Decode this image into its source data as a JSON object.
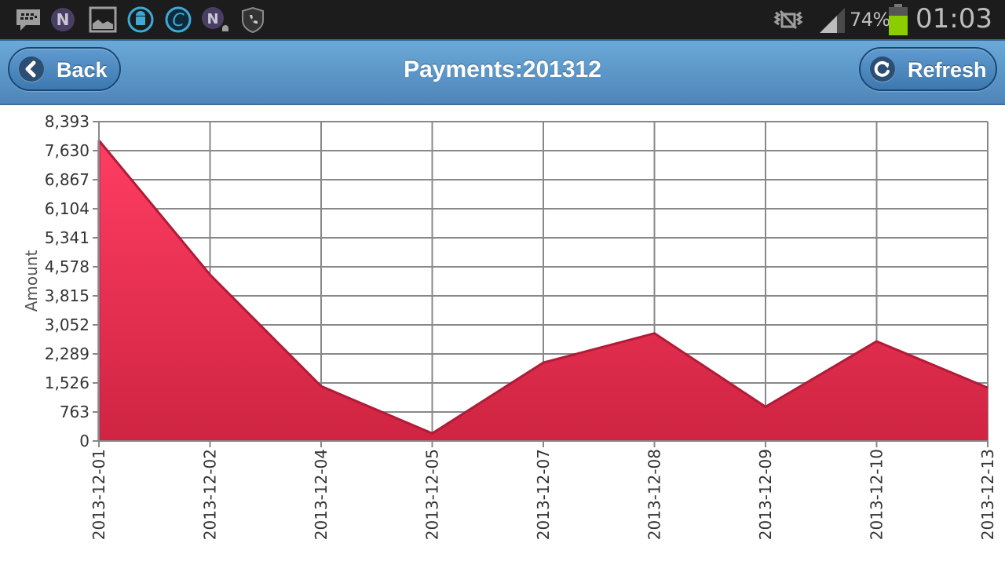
{
  "status_bar": {
    "left_icons": [
      "bbm-icon",
      "notification-n-icon",
      "gallery-image-icon",
      "android-sync-icon",
      "c-app-icon",
      "notification-n-bell-icon",
      "shield-phone-icon"
    ],
    "right_icons": [
      "vibrate-mute-icon",
      "signal-icon",
      "battery-icon"
    ],
    "battery_percent": "74%",
    "time": "01:03",
    "battery_color": "#8ccc00"
  },
  "header": {
    "title": "Payments:201312",
    "back_label": "Back",
    "refresh_label": "Refresh",
    "header_color": "#5b95c7"
  },
  "chart_data": {
    "type": "area",
    "title": "",
    "xlabel": "",
    "ylabel": "Amount",
    "categories": [
      "2013-12-01",
      "2013-12-02",
      "2013-12-04",
      "2013-12-05",
      "2013-12-07",
      "2013-12-08",
      "2013-12-09",
      "2013-12-10",
      "2013-12-13"
    ],
    "series": [
      {
        "name": "Amount",
        "values": [
          7900,
          4370,
          1440,
          200,
          2060,
          2830,
          900,
          2620,
          1400
        ],
        "color": "#d62a48"
      }
    ],
    "yticks": [
      0,
      763,
      1526,
      2289,
      3052,
      3815,
      4578,
      5341,
      6104,
      6867,
      7630,
      8393
    ],
    "ytick_labels": [
      "0",
      "763",
      "1,526",
      "2,289",
      "3,052",
      "3,815",
      "4,578",
      "5,341",
      "6,104",
      "6,867",
      "7,630",
      "8,393"
    ],
    "ylim": [
      0,
      8393
    ],
    "grid": true,
    "legend": "none"
  }
}
